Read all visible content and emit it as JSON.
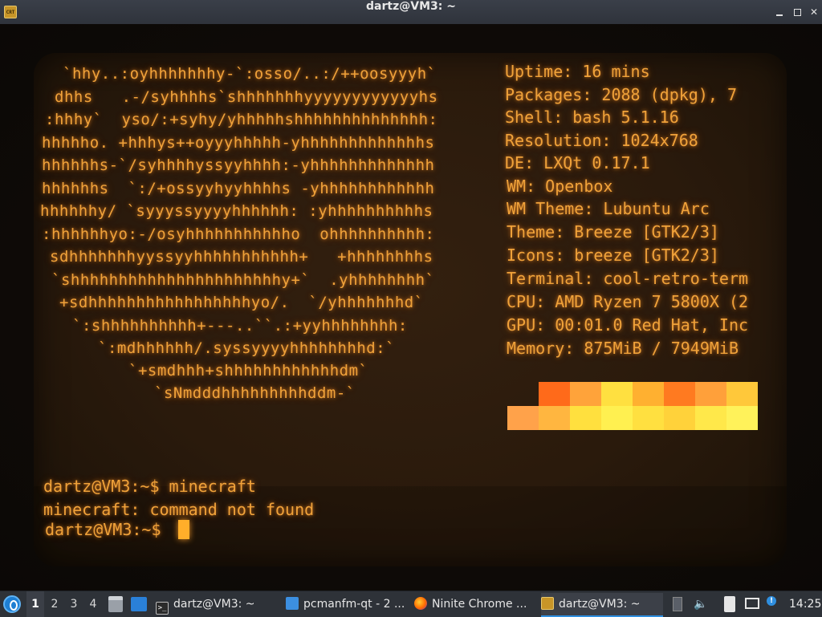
{
  "window": {
    "title": "dartz@VM3: ~",
    "icon_text": "CRT",
    "controls": [
      "minimize-icon",
      "maximize-icon",
      "close-icon"
    ]
  },
  "terminal": {
    "logo_lines": [
      "`hhy..:oyhhhhhhhy-`:osso/..:/++oosyyyh`",
      "dhhs   .-/syhhhhs`shhhhhhhyyyyyyyyyyyyhs",
      ":hhhy`  yso/:+syhy/yhhhhhshhhhhhhhhhhhhh:",
      "hhhhho. +hhhys++oyyyhhhhh-yhhhhhhhhhhhhhs",
      "hhhhhhs-`/syhhhhyssyyhhhh:-yhhhhhhhhhhhhh",
      "hhhhhhs  `:/+ossyyhyyhhhhs -yhhhhhhhhhhhh",
      "hhhhhhy/ `syyyssyyyyhhhhhh: :yhhhhhhhhhhs",
      ":hhhhhhyo:-/osyhhhhhhhhhhho  ohhhhhhhhhh:",
      "sdhhhhhhhyyssyyhhhhhhhhhhh+   +hhhhhhhhs",
      "`shhhhhhhhhhhhhhhhhhhhhhy+`  .yhhhhhhhh`",
      "+sdhhhhhhhhhhhhhhhhhyo/.  `/yhhhhhhhd`",
      "`:shhhhhhhhhh+---..``.:+yyhhhhhhhh:",
      "`:mdhhhhhh/.syssyyyyhhhhhhhhd:`",
      "`+smdhhh+shhhhhhhhhhhhdm`",
      "`sNmdddhhhhhhhhhddm-`"
    ],
    "info_lines": [
      "Uptime: 16 mins",
      "Packages: 2088 (dpkg), 7",
      "Shell: bash 5.1.16",
      "Resolution: 1024x768",
      "DE: LXQt 0.17.1",
      "WM: Openbox",
      "WM Theme: Lubuntu Arc",
      "Theme: Breeze [GTK2/3]",
      "Icons: breeze [GTK2/3]",
      "Terminal: cool-retro-term",
      "CPU: AMD Ryzen 7 5800X (2",
      "GPU: 00:01.0 Red Hat, Inc",
      "Memory: 875MiB / 7949MiB"
    ],
    "color_blocks_top": [
      "#000000",
      "#ff6a1a",
      "#ffa33a",
      "#ffe040",
      "#ffb030",
      "#ff7a20",
      "#ffa03a",
      "#ffc83a"
    ],
    "color_blocks_bottom": [
      "#ffa24a",
      "#ffb640",
      "#ffe03e",
      "#fff050",
      "#ffe040",
      "#ffd23a",
      "#ffe84a",
      "#fff25a"
    ],
    "prompt_lines": [
      "dartz@VM3:~$ minecraft",
      "minecraft: command not found",
      "dartz@VM3:~$ "
    ]
  },
  "taskbar": {
    "workspaces": [
      "1",
      "2",
      "3",
      "4"
    ],
    "tasks": [
      {
        "label": "dartz@VM3: ~",
        "icon": "terminal-icon"
      },
      {
        "label": "pcmanfm-qt - 2 ...",
        "icon": "folder-icon"
      },
      {
        "label": "Ninite Chrome ...",
        "icon": "firefox-icon"
      },
      {
        "label": "dartz@VM3: ~",
        "icon": "crt-icon"
      }
    ],
    "clock": "14:25"
  }
}
